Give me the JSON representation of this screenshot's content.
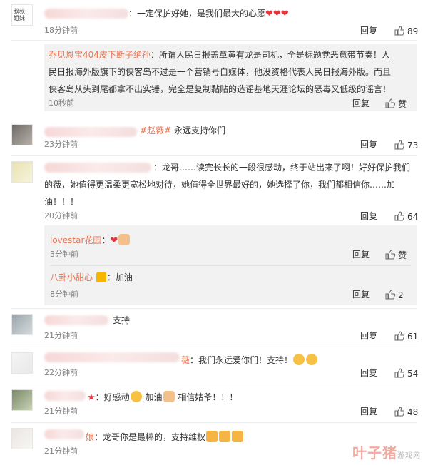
{
  "comments": [
    {
      "name": "",
      "text": "：一定保护好她，是我们最大的心愿",
      "time": "18分钟前",
      "reply": "回复",
      "likes": "89",
      "avatar_text": "叔叔·姐妹"
    },
    {
      "name": "乔见恩宝404皮下断子绝孙",
      "lines": [
        "：所谓人民日报盖章黄有龙是司机，全是标题党恶意带节奏！人",
        "民日报海外版旗下的侠客岛不过是一个营销号自媒体，他没资格代表人民日报海外版。而且",
        "侠客岛从头到尾都拿不出实锤，完全是复制黏贴的造谣基地天涯论坛的恶毒又低级的谣言！"
      ],
      "time": "10秒前",
      "reply": "回复",
      "likes": "赞"
    },
    {
      "mention": "#赵薇#",
      "text": "永远支持你们",
      "time": "23分钟前",
      "reply": "回复",
      "likes": "73"
    },
    {
      "lines": [
        "：龙哥……读完长长的一段很感动，终于站出来了啊！好好保护我们",
        "的薇，她值得更温柔更宽松地对待，她值得全世界最好的，她选择了你，我们都相信你……加",
        "油！！！"
      ],
      "time": "20分钟前",
      "reply": "回复",
      "likes": "64",
      "subreplies": [
        {
          "name": "lovestar花园",
          "text": "：",
          "time": "3分钟前",
          "reply": "回复",
          "likes": "赞"
        },
        {
          "name": "八卦小甜心",
          "text": "：加油",
          "time": "8分钟前",
          "reply": "回复",
          "likes": "2"
        }
      ]
    },
    {
      "text": "支持",
      "time": "21分钟前",
      "reply": "回复",
      "likes": "61"
    },
    {
      "mention": "薇",
      "text": "：我们永远爱你们！支持！",
      "time": "22分钟前",
      "reply": "回复",
      "likes": "54"
    },
    {
      "text": "：好感动",
      "text2": "加油",
      "text3": "相信姑爷！！！",
      "time": "21分钟前",
      "reply": "回复",
      "likes": "48"
    },
    {
      "mention": "娘",
      "text": "：龙哥你是最棒的，支持维权",
      "time": "21分钟前",
      "reply": "回复",
      "likes": ""
    }
  ],
  "watermark": {
    "main": "叶子猪",
    "sub": "游戏网"
  },
  "colors": {
    "accent": "#eb7350",
    "heart": "#e8343a",
    "subbox": "#f2f2f2"
  }
}
